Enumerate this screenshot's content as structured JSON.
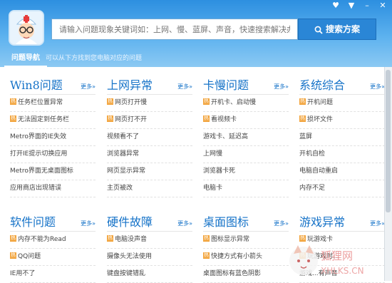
{
  "window": {
    "controls": [
      "♥",
      "▼",
      "–",
      "✕"
    ]
  },
  "search": {
    "placeholder": "请输入问题现象关键词如：上网、慢、蓝屏、声音，快速搜索解决办法",
    "button_label": "搜索方案"
  },
  "nav": {
    "active_tab": "问题导航",
    "hint": "可以从下方找到您电脑对应的问题"
  },
  "more_label": "更多»",
  "hot_badge": "热",
  "categories": [
    {
      "title": "Win8问题",
      "items": [
        {
          "text": "任务栏位置异常",
          "hot": true
        },
        {
          "text": "无法固定到任务栏",
          "hot": true
        },
        {
          "text": "Metro界面的IE失效",
          "hot": false
        },
        {
          "text": "打开IE提示切换应用",
          "hot": false
        },
        {
          "text": "Metro界面无桌面图标",
          "hot": false
        },
        {
          "text": "应用商店出现错误",
          "hot": false
        }
      ]
    },
    {
      "title": "上网异常",
      "items": [
        {
          "text": "网页打开慢",
          "hot": true
        },
        {
          "text": "网页打不开",
          "hot": true
        },
        {
          "text": "视频看不了",
          "hot": false
        },
        {
          "text": "浏览器异常",
          "hot": false
        },
        {
          "text": "网页显示异常",
          "hot": false
        },
        {
          "text": "主页被改",
          "hot": false
        }
      ]
    },
    {
      "title": "卡慢问题",
      "items": [
        {
          "text": "开机卡、启动慢",
          "hot": true
        },
        {
          "text": "看视频卡",
          "hot": true
        },
        {
          "text": "游戏卡、延迟高",
          "hot": false
        },
        {
          "text": "上网慢",
          "hot": false
        },
        {
          "text": "浏览器卡死",
          "hot": false
        },
        {
          "text": "电脑卡",
          "hot": false
        }
      ]
    },
    {
      "title": "系统综合",
      "items": [
        {
          "text": "开机问题",
          "hot": true
        },
        {
          "text": "损坏文件",
          "hot": true
        },
        {
          "text": "蓝屏",
          "hot": false
        },
        {
          "text": "开机自检",
          "hot": false
        },
        {
          "text": "电脑自动重启",
          "hot": false
        },
        {
          "text": "内存不足",
          "hot": false
        }
      ]
    },
    {
      "title": "软件问题",
      "items": [
        {
          "text": "内存不能为Read",
          "hot": true
        },
        {
          "text": "QQ问题",
          "hot": true
        },
        {
          "text": "IE用不了",
          "hot": false
        }
      ]
    },
    {
      "title": "硬件故障",
      "items": [
        {
          "text": "电脑没声音",
          "hot": true
        },
        {
          "text": "摄像头无法使用",
          "hot": false
        },
        {
          "text": "键盘按键错乱",
          "hot": false
        }
      ]
    },
    {
      "title": "桌面图标",
      "items": [
        {
          "text": "图标显示异常",
          "hot": true
        },
        {
          "text": "快捷方式有小箭头",
          "hot": true
        },
        {
          "text": "桌面图标有蓝色阴影",
          "hot": false
        }
      ]
    },
    {
      "title": "游戏异常",
      "items": [
        {
          "text": "玩游戏卡",
          "hot": true
        },
        {
          "text": "玩游戏时...",
          "hot": true
        },
        {
          "text": "游戏...有声音",
          "hot": false
        }
      ]
    }
  ],
  "watermark": {
    "text_cn": "狐狸网",
    "text_en": "XHLKS.CN"
  }
}
